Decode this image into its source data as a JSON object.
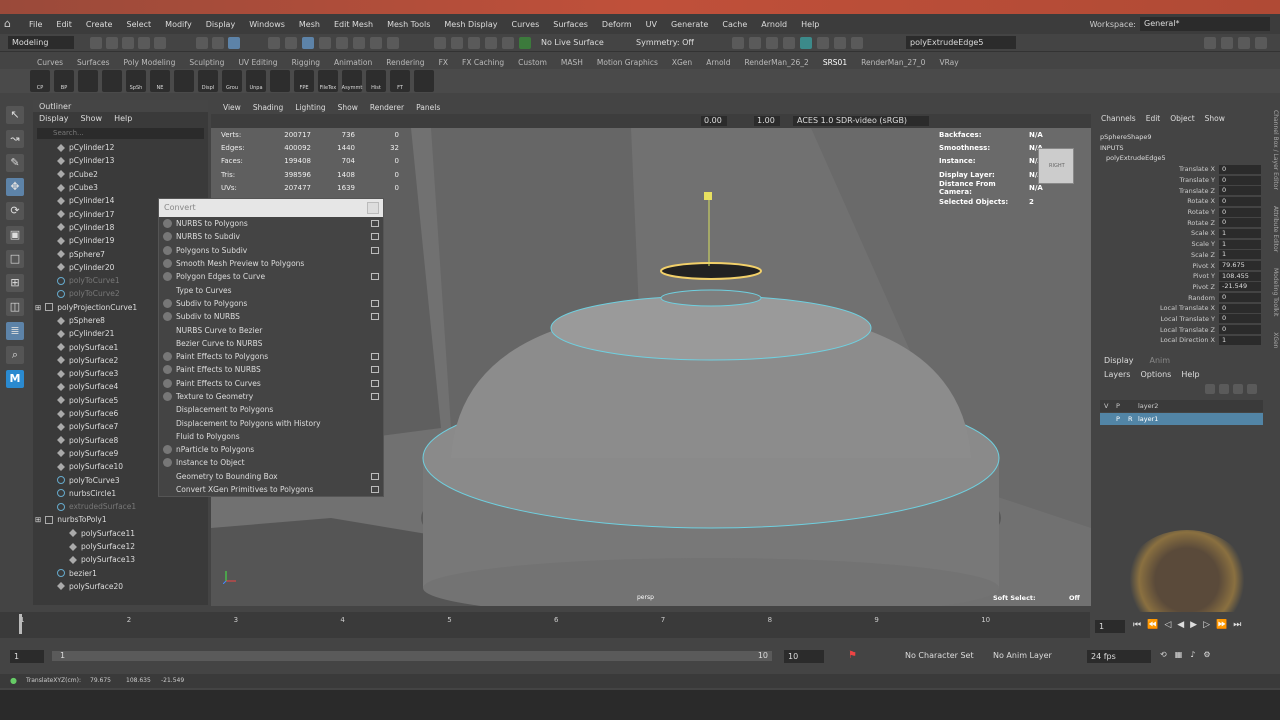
{
  "menubar": {
    "items": [
      "File",
      "Edit",
      "Create",
      "Select",
      "Modify",
      "Display",
      "Windows",
      "Mesh",
      "Edit Mesh",
      "Mesh Tools",
      "Mesh Display",
      "Curves",
      "Surfaces",
      "Deform",
      "UV",
      "Generate",
      "Cache",
      "Arnold",
      "Help"
    ],
    "workspace_label": "Workspace:",
    "workspace_value": "General*"
  },
  "statusline": {
    "mode": "Modeling",
    "live_surface": "No Live Surface",
    "symmetry": "Symmetry: Off",
    "name_field": "polyExtrudeEdge5"
  },
  "shelf": {
    "tabs": [
      "Curves",
      "Surfaces",
      "Poly Modeling",
      "Sculpting",
      "UV Editing",
      "Rigging",
      "Animation",
      "Rendering",
      "FX",
      "FX Caching",
      "Custom",
      "MASH",
      "Motion Graphics",
      "XGen",
      "Arnold",
      "RenderMan_26_2",
      "SRS01",
      "RenderMan_27_0",
      "VRay"
    ],
    "active_tab": "SRS01",
    "icons": [
      "CP",
      "BP",
      "",
      "",
      "SpSh",
      "NE",
      "",
      "Displ",
      "Grou",
      "Unpa",
      "",
      "FPE",
      "FileTex",
      "Asymmt",
      "Hist",
      "FT",
      ""
    ]
  },
  "outliner": {
    "title": "Outliner",
    "menu": [
      "Display",
      "Show",
      "Help"
    ],
    "search_placeholder": "Search...",
    "items": [
      {
        "label": "pCylinder12",
        "type": "mesh",
        "indent": 1
      },
      {
        "label": "pCylinder13",
        "type": "mesh",
        "indent": 1
      },
      {
        "label": "pCube2",
        "type": "mesh",
        "indent": 1
      },
      {
        "label": "pCube3",
        "type": "mesh",
        "indent": 1
      },
      {
        "label": "pCylinder14",
        "type": "mesh",
        "indent": 1
      },
      {
        "label": "pCylinder17",
        "type": "mesh",
        "indent": 1
      },
      {
        "label": "pCylinder18",
        "type": "mesh",
        "indent": 1
      },
      {
        "label": "pCylinder19",
        "type": "mesh",
        "indent": 1
      },
      {
        "label": "pSphere7",
        "type": "mesh",
        "indent": 1
      },
      {
        "label": "pCylinder20",
        "type": "mesh",
        "indent": 1
      },
      {
        "label": "polyToCurve1",
        "type": "curve",
        "indent": 1,
        "dim": true
      },
      {
        "label": "polyToCurve2",
        "type": "curve",
        "indent": 1,
        "dim": true
      },
      {
        "label": "polyProjectionCurve1",
        "type": "grp",
        "indent": 0
      },
      {
        "label": "pSphere8",
        "type": "mesh",
        "indent": 1
      },
      {
        "label": "pCylinder21",
        "type": "mesh",
        "indent": 1
      },
      {
        "label": "polySurface1",
        "type": "mesh",
        "indent": 1
      },
      {
        "label": "polySurface2",
        "type": "mesh",
        "indent": 1
      },
      {
        "label": "polySurface3",
        "type": "mesh",
        "indent": 1
      },
      {
        "label": "polySurface4",
        "type": "mesh",
        "indent": 1
      },
      {
        "label": "polySurface5",
        "type": "mesh",
        "indent": 1
      },
      {
        "label": "polySurface6",
        "type": "mesh",
        "indent": 1
      },
      {
        "label": "polySurface7",
        "type": "mesh",
        "indent": 1
      },
      {
        "label": "polySurface8",
        "type": "mesh",
        "indent": 1
      },
      {
        "label": "polySurface9",
        "type": "mesh",
        "indent": 1
      },
      {
        "label": "polySurface10",
        "type": "mesh",
        "indent": 1
      },
      {
        "label": "polyToCurve3",
        "type": "curve",
        "indent": 1
      },
      {
        "label": "nurbsCircle1",
        "type": "curve",
        "indent": 1
      },
      {
        "label": "extrudedSurface1",
        "type": "curve",
        "indent": 1,
        "dim": true
      },
      {
        "label": "nurbsToPoly1",
        "type": "grp",
        "indent": 0
      },
      {
        "label": "polySurface11",
        "type": "mesh",
        "indent": 2
      },
      {
        "label": "polySurface12",
        "type": "mesh",
        "indent": 2
      },
      {
        "label": "polySurface13",
        "type": "mesh",
        "indent": 2
      },
      {
        "label": "bezier1",
        "type": "curve",
        "indent": 1
      },
      {
        "label": "polySurface20",
        "type": "mesh",
        "indent": 1
      }
    ]
  },
  "viewport": {
    "menu": [
      "View",
      "Shading",
      "Lighting",
      "Show",
      "Renderer",
      "Panels"
    ],
    "exposure": "0.00",
    "gamma": "1.00",
    "colorspace": "ACES 1.0 SDR-video (sRGB)",
    "hud_left": [
      {
        "k": "Verts:",
        "a": "200717",
        "b": "736",
        "c": "0"
      },
      {
        "k": "Edges:",
        "a": "400092",
        "b": "1440",
        "c": "32"
      },
      {
        "k": "Faces:",
        "a": "199408",
        "b": "704",
        "c": "0"
      },
      {
        "k": "Tris:",
        "a": "398596",
        "b": "1408",
        "c": "0"
      },
      {
        "k": "UVs:",
        "a": "207477",
        "b": "1639",
        "c": "0"
      }
    ],
    "hud_right": [
      {
        "k": "Backfaces:",
        "v": "N/A"
      },
      {
        "k": "Smoothness:",
        "v": "N/A"
      },
      {
        "k": "Instance:",
        "v": "N/A"
      },
      {
        "k": "Display Layer:",
        "v": "N/A"
      },
      {
        "k": "Distance From Camera:",
        "v": "N/A"
      },
      {
        "k": "Selected Objects:",
        "v": "2"
      }
    ],
    "camera": "persp",
    "soft_select_label": "Soft Select:",
    "soft_select_value": "Off",
    "cube_label": "RIGHT"
  },
  "convert_menu": {
    "title": "Convert",
    "items": [
      {
        "label": "NURBS to Polygons",
        "icon": true,
        "opt": true
      },
      {
        "label": "NURBS to Subdiv",
        "icon": true,
        "opt": true
      },
      {
        "label": "Polygons to Subdiv",
        "icon": true,
        "opt": true
      },
      {
        "label": "Smooth Mesh Preview to Polygons",
        "icon": true,
        "opt": false
      },
      {
        "label": "Polygon Edges to Curve",
        "icon": true,
        "opt": true
      },
      {
        "label": "Type to Curves",
        "icon": false,
        "opt": false
      },
      {
        "label": "Subdiv to Polygons",
        "icon": true,
        "opt": true
      },
      {
        "label": "Subdiv to NURBS",
        "icon": true,
        "opt": true
      },
      {
        "label": "NURBS Curve to Bezier",
        "icon": false,
        "opt": false
      },
      {
        "label": "Bezier Curve to NURBS",
        "icon": false,
        "opt": false
      },
      {
        "label": "Paint Effects to Polygons",
        "icon": true,
        "opt": true
      },
      {
        "label": "Paint Effects to NURBS",
        "icon": true,
        "opt": true
      },
      {
        "label": "Paint Effects to Curves",
        "icon": true,
        "opt": true
      },
      {
        "label": "Texture to Geometry",
        "icon": true,
        "opt": true
      },
      {
        "label": "Displacement to Polygons",
        "icon": false,
        "opt": false
      },
      {
        "label": "Displacement to Polygons with History",
        "icon": false,
        "opt": false
      },
      {
        "label": "Fluid to Polygons",
        "icon": false,
        "opt": false
      },
      {
        "label": "nParticle to Polygons",
        "icon": true,
        "opt": false
      },
      {
        "label": "Instance to Object",
        "icon": true,
        "opt": false
      },
      {
        "label": "Geometry to Bounding Box",
        "icon": false,
        "opt": true
      },
      {
        "label": "Convert XGen Primitives to Polygons",
        "icon": false,
        "opt": true
      }
    ]
  },
  "channelbox": {
    "menu": [
      "Channels",
      "Edit",
      "Object",
      "Show"
    ],
    "node": "pSphereShape9",
    "inputs_label": "INPUTS",
    "input_node": "polyExtrudeEdge5",
    "attrs": [
      {
        "k": "Translate X",
        "v": "0"
      },
      {
        "k": "Translate Y",
        "v": "0"
      },
      {
        "k": "Translate Z",
        "v": "0"
      },
      {
        "k": "Rotate X",
        "v": "0"
      },
      {
        "k": "Rotate Y",
        "v": "0"
      },
      {
        "k": "Rotate Z",
        "v": "0"
      },
      {
        "k": "Scale X",
        "v": "1"
      },
      {
        "k": "Scale Y",
        "v": "1"
      },
      {
        "k": "Scale Z",
        "v": "1"
      },
      {
        "k": "Pivot X",
        "v": "79.675"
      },
      {
        "k": "Pivot Y",
        "v": "108.455"
      },
      {
        "k": "Pivot Z",
        "v": "-21.549"
      },
      {
        "k": "Random",
        "v": "0"
      },
      {
        "k": "Local Translate X",
        "v": "0"
      },
      {
        "k": "Local Translate Y",
        "v": "0"
      },
      {
        "k": "Local Translate Z",
        "v": "0"
      },
      {
        "k": "Local Direction X",
        "v": "1"
      }
    ],
    "side_tabs": [
      "Channel Box / Layer Editor",
      "Attribute Editor",
      "Modeling Toolkit",
      "XGen"
    ]
  },
  "layers": {
    "tabs": [
      "Display",
      "Anim"
    ],
    "menu": [
      "Layers",
      "Options",
      "Help"
    ],
    "rows": [
      {
        "v": "V",
        "p": "P",
        "name": "layer2",
        "selected": false
      },
      {
        "v": "",
        "p": "P",
        "r": "R",
        "name": "layer1",
        "selected": true
      }
    ]
  },
  "timeline": {
    "ticks": [
      "1",
      "2",
      "3",
      "4",
      "5",
      "6",
      "7",
      "8",
      "9",
      "10"
    ],
    "current_frame": "1",
    "range_start": "1",
    "range_inner_start": "1",
    "range_inner_end": "10",
    "range_end": "10",
    "character_set": "No Character Set",
    "anim_layer": "No Anim Layer",
    "fps": "24 fps"
  },
  "helpline": {
    "label": "TranslateXYZ(cm):",
    "x": "79.675",
    "y": "108.635",
    "z": "-21.549"
  }
}
